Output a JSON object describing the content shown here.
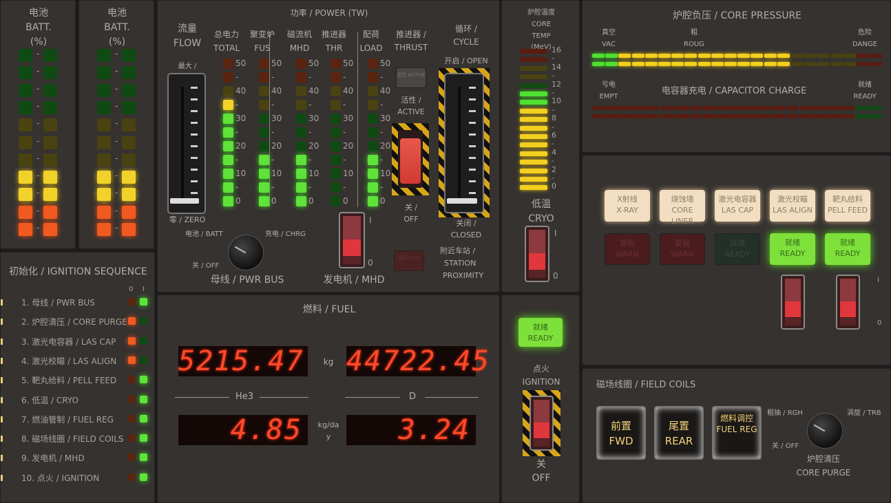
{
  "battery": [
    {
      "label_cn": "电池",
      "label_en": "BATT.",
      "unit": "(%)",
      "lit_segments": 4,
      "total_segments": 11
    },
    {
      "label_cn": "电池",
      "label_en": "BATT.",
      "unit": "(%)",
      "lit_segments": 4,
      "total_segments": 11
    }
  ],
  "ignition_sequence": {
    "title": "初始化 / IGNITION SEQUENCE",
    "col0": "0",
    "col1": "I",
    "items": [
      {
        "label": "1. 母线 / PWR BUS",
        "state": 1
      },
      {
        "label": "2. 炉腔清压 / CORE PURGE",
        "state": 0
      },
      {
        "label": "3. 激光电容器 / LAS CAP",
        "state": 0
      },
      {
        "label": "4. 激光校瞄 / LAS ALIGN",
        "state": 0
      },
      {
        "label": "5. 靶丸给料 / PELL FEED",
        "state": 1
      },
      {
        "label": "6. 低温 / CRYO",
        "state": 1
      },
      {
        "label": "7. 燃油管制 / FUEL REG",
        "state": 1
      },
      {
        "label": "8. 磁场线圈 / FIELD COILS",
        "state": 1
      },
      {
        "label": "9. 发电机 / MHD",
        "state": 1
      },
      {
        "label": "10. 点火 / IGNITION",
        "state": 1
      }
    ]
  },
  "power": {
    "title": "功率 / POWER (TW)",
    "flow": {
      "cn": "流量",
      "en": "FLOW",
      "max": "最大 /",
      "zero": "零 / ZERO",
      "value_fraction": 0.0
    },
    "scale": [
      "50",
      "-",
      "40",
      "-",
      "30",
      "-",
      "20",
      "-",
      "10",
      "-",
      "0"
    ],
    "meters": [
      {
        "cn": "总电力",
        "en": "TOTAL",
        "value": 35
      },
      {
        "cn": "聚变炉",
        "en": "FUS",
        "value": 15
      },
      {
        "cn": "磁流机",
        "en": "MHD",
        "value": 15
      },
      {
        "cn": "推进器",
        "en": "THR",
        "value": -5
      },
      {
        "cn": "配荷",
        "en": "LOAD",
        "value": 15
      }
    ],
    "thrust": {
      "label": "推进器 / THRUST",
      "btn": "活性 ACTIVE",
      "active": "活性 /",
      "active_en": "ACTIVE",
      "off": "关 /",
      "off_en": "OFF"
    },
    "cycle": {
      "label_cn": "循环 /",
      "label_en": "CYCLE",
      "open": "开启 / OPEN",
      "closed_cn": "关闭 /",
      "closed_en": "CLOSED",
      "value_fraction": 0.0
    },
    "pwr_bus": {
      "batt": "电池 / BATT",
      "chrg": "充电 / CHRG",
      "off": "关 / OFF",
      "label": "母线 / PWR BUS"
    },
    "mhd": {
      "on": "I",
      "off": "0",
      "label": "发电机 / MHD"
    },
    "station": {
      "btn": "靠近 Prox",
      "cn": "附近车站 /",
      "en1": "STATION",
      "en2": "PROXIMITY"
    }
  },
  "fuel": {
    "title": "燃料 / FUEL",
    "he3_mass": "5215.47",
    "d_mass": "44722.45",
    "mass_unit": "kg",
    "he3_label": "He3",
    "d_label": "D",
    "he3_rate": "4.85",
    "d_rate": "3.24",
    "rate_unit": "kg/da\ny"
  },
  "core_temp": {
    "cn": "炉腔温度",
    "en1": "CORE",
    "en2": "TEMP",
    "unit": "(MeV)",
    "value": 11,
    "scale": [
      "16",
      "-",
      "14",
      "-",
      "12",
      "-",
      "10",
      "-",
      "8",
      "-",
      "6",
      "-",
      "4",
      "-",
      "2",
      "-",
      "0"
    ]
  },
  "cryo": {
    "cn": "低温",
    "en": "CRYO",
    "on": "I",
    "off": "0"
  },
  "ignition": {
    "ready_cn": "就绪",
    "ready_en": "READY",
    "cn": "点火",
    "en": "IGNITION",
    "off_cn": "关",
    "off_en": "OFF"
  },
  "core_pressure": {
    "title": "炉腔负压 / CORE PRESSURE",
    "vac_cn": "真空",
    "vac_en": "VAC",
    "roug_cn": "粗",
    "roug_en": "ROUG",
    "dang_cn": "危险",
    "dang_en": "DANGE",
    "lit_segments": 15,
    "total_segments": 22
  },
  "capacitor": {
    "title": "电容器充电 / CAPACITOR CHARGE",
    "empt_cn": "亏电",
    "empt_en": "EMPT",
    "ready_cn": "就绪",
    "ready_en": "READY",
    "lit_segments": 0,
    "total_segments": 21
  },
  "status_lamps": {
    "top": [
      {
        "cn": "X射线",
        "en": "X-RAY"
      },
      {
        "cn": "烧蚀墙",
        "en": "CORE LINER"
      },
      {
        "cn": "激光电容器",
        "en": "LAS CAP"
      },
      {
        "cn": "激光校瞄",
        "en": "LAS ALIGN"
      },
      {
        "cn": "靶丸给料",
        "en": "PELL FEED"
      }
    ],
    "bottom": [
      {
        "cn": "警报",
        "en": "WARN",
        "state": "warn"
      },
      {
        "cn": "警报",
        "en": "WARN",
        "state": "warn"
      },
      {
        "cn": "就绪",
        "en": "READY",
        "state": "dark"
      },
      {
        "cn": "就绪",
        "en": "READY",
        "state": "ready"
      },
      {
        "cn": "就绪",
        "en": "READY",
        "state": "ready"
      }
    ],
    "switch_on": "I",
    "switch_off": "0"
  },
  "field_coils": {
    "title": "磁场线圈 / FIELD COILS",
    "buttons": [
      {
        "cn": "前置",
        "en": "FWD"
      },
      {
        "cn": "尾置",
        "en": "REAR"
      },
      {
        "cn": "燃料调控",
        "en": "FUEL REG"
      }
    ],
    "purge": {
      "rgh": "粗抽 / RGH",
      "trb": "涡旋 / TRB",
      "off": "关 / OFF",
      "cn": "炉腔清压",
      "en": "CORE PURGE"
    }
  }
}
